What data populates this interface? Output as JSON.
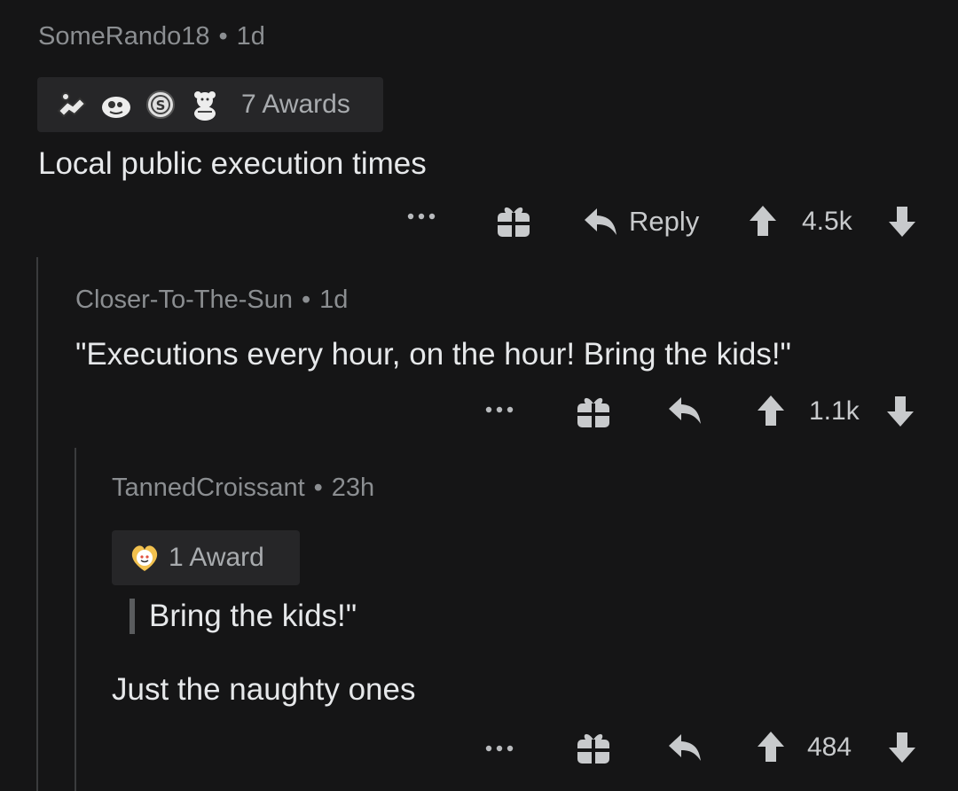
{
  "comments": [
    {
      "author": "SomeRando18",
      "age": "1d",
      "awards_label": "7 Awards",
      "award_icons": [
        "handshake-award-icon",
        "blob-award-icon",
        "silver-coin-award-icon",
        "bear-award-icon"
      ],
      "body": "Local public execution times",
      "reply_label": "Reply",
      "score": "4.5k"
    },
    {
      "author": "Closer-To-The-Sun",
      "age": "1d",
      "body": "\"Executions every hour, on the hour! Bring the kids!\"",
      "score": "1.1k"
    },
    {
      "author": "TannedCroissant",
      "age": "23h",
      "awards_label": "1 Award",
      "award_icons": [
        "wholesome-heart-award-icon"
      ],
      "quote": "Bring the kids!\"",
      "body": "Just the naughty ones",
      "score": "484"
    }
  ],
  "separator": "•",
  "more_label": "•••",
  "colors": {
    "background": "#151516",
    "meta": "#8b8e91",
    "text": "#e6e8ea",
    "award_bg": "#262628",
    "thread_line": "#3a3b3d"
  }
}
